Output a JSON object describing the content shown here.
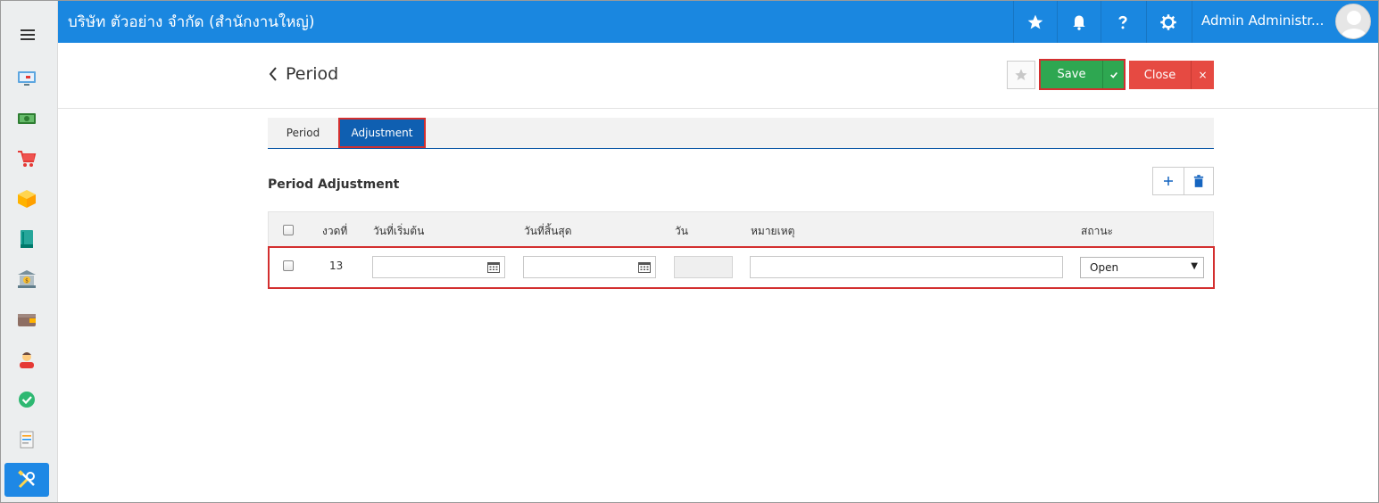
{
  "app": {
    "company": "บริษัท ตัวอย่าง จำกัด (สำนักงานใหญ่)",
    "user_name": "Admin Administr...",
    "colors": {
      "topbar": "#1a87e0",
      "save": "#2ea751",
      "close": "#e64a42",
      "active_tab": "#0f5fb1",
      "highlight": "#d32f2f"
    }
  },
  "sidebar": {
    "items": [
      {
        "icon": "monitor-icon"
      },
      {
        "icon": "money-icon"
      },
      {
        "icon": "cart-icon"
      },
      {
        "icon": "box-icon"
      },
      {
        "icon": "book-icon"
      },
      {
        "icon": "bank-icon"
      },
      {
        "icon": "wallet-icon"
      },
      {
        "icon": "person-icon"
      },
      {
        "icon": "check-circle-icon"
      },
      {
        "icon": "report-icon"
      },
      {
        "icon": "tools-icon",
        "active": true
      }
    ]
  },
  "header": {
    "title": "Period",
    "save_label": "Save",
    "close_label": "Close",
    "close_x": "×"
  },
  "tabs": [
    {
      "label": "Period",
      "active": false
    },
    {
      "label": "Adjustment",
      "active": true
    }
  ],
  "section": {
    "title": "Period Adjustment"
  },
  "table": {
    "columns": [
      "งวดที่",
      "วันที่เริ่มต้น",
      "วันที่สิ้นสุด",
      "วัน",
      "หมายเหตุ",
      "สถานะ"
    ],
    "rows": [
      {
        "period": "13",
        "start_date": "",
        "end_date": "",
        "days": "",
        "note": "",
        "status": "Open"
      }
    ],
    "status_arrow": "▼"
  }
}
